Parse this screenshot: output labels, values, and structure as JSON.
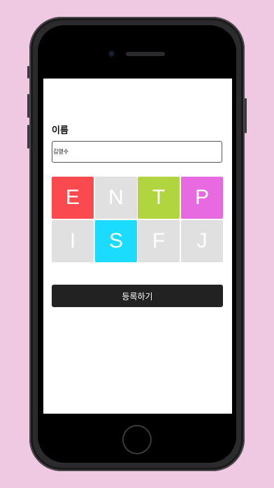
{
  "form": {
    "name_label": "이름",
    "name_value": "김영수",
    "register_label": "등록하기"
  },
  "mbti": {
    "tiles": [
      {
        "letter": "E",
        "selected": true,
        "color": "#fb4a4f"
      },
      {
        "letter": "N",
        "selected": false,
        "color": "#e0e0e0"
      },
      {
        "letter": "T",
        "selected": true,
        "color": "#b0d53e"
      },
      {
        "letter": "P",
        "selected": true,
        "color": "#e76ae0"
      },
      {
        "letter": "I",
        "selected": false,
        "color": "#e0e0e0"
      },
      {
        "letter": "S",
        "selected": true,
        "color": "#1bdcff"
      },
      {
        "letter": "F",
        "selected": false,
        "color": "#e0e0e0"
      },
      {
        "letter": "J",
        "selected": false,
        "color": "#e0e0e0"
      }
    ]
  },
  "colors": {
    "background": "#efc8e2",
    "button": "#222222"
  }
}
